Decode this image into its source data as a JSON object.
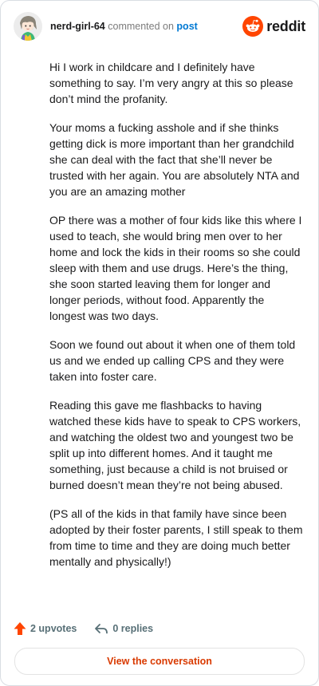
{
  "header": {
    "username": "nerd-girl-64",
    "action_text": "commented on",
    "post_link": "post",
    "brand_name": "reddit",
    "brand_color": "#ff4500"
  },
  "comment": {
    "paragraphs": [
      "Hi I work in childcare and I definitely have something to say. I’m very angry at this so please don’t mind the profanity.",
      "Your moms a fucking asshole and if she thinks getting dick is more important than her grandchild she can deal with the fact that she’ll never be trusted with her again. You are absolutely NTA and you are an amazing mother",
      "OP there was a mother of four kids like this where I used to teach, she would bring men over to her home and lock the kids in their rooms so she could sleep with them and use drugs. Here’s the thing, she soon started leaving them for longer and longer periods, without food. Apparently the longest was two days.",
      "Soon we found out about it when one of them told us and we ended up calling CPS and they were taken into foster care.",
      "Reading this gave me flashbacks to having watched these kids have to speak to CPS workers, and watching the oldest two and youngest two be split up into different homes. And it taught me something, just because a child is not bruised or burned doesn’t mean they’re not being abused.",
      "(PS all of the kids in that family have since been adopted by their foster parents, I still speak to them from time to time and they are doing much better mentally and physically!)"
    ]
  },
  "footer": {
    "upvotes": "2 upvotes",
    "replies": "0 replies",
    "view_button": "View the conversation",
    "upvote_color": "#ff4500",
    "view_button_color": "#d93a00"
  },
  "icons": {
    "avatar": "avatar-icon",
    "brand": "reddit-logo-icon",
    "upvote": "upvote-arrow-icon",
    "reply": "reply-arrow-icon"
  }
}
